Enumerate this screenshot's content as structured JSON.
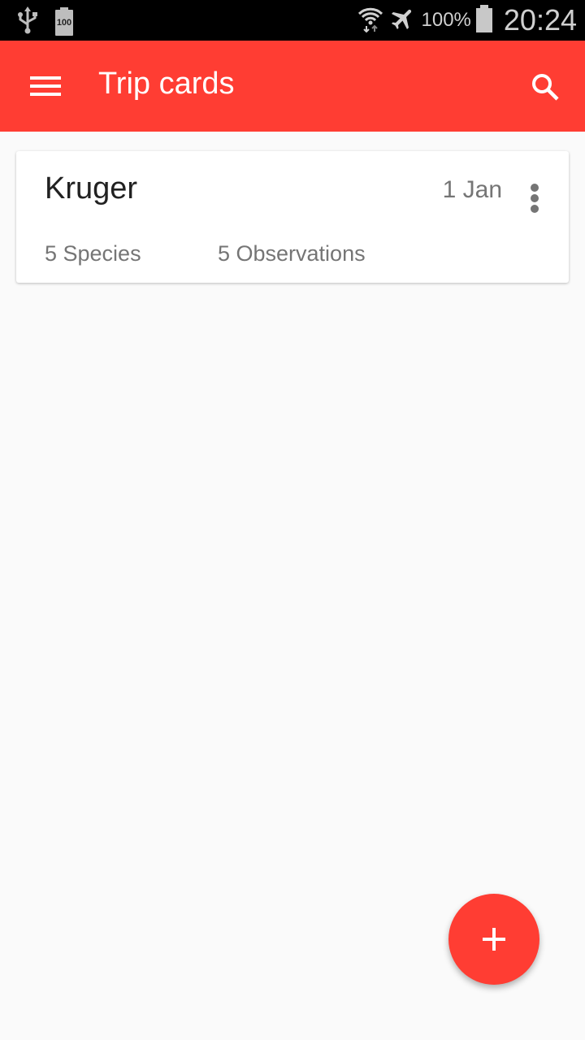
{
  "status_bar": {
    "icons_left": [
      "usb-icon",
      "battery-100-icon"
    ],
    "battery_small_label": "100",
    "icons_right": [
      "wifi-icon",
      "airplane-mode-icon",
      "battery-icon"
    ],
    "battery_percent": "100%",
    "time": "20:24"
  },
  "app_bar": {
    "title": "Trip cards",
    "background_color": "#ff3d33",
    "menu_icon": "hamburger-menu-icon",
    "search_icon": "search-icon"
  },
  "trips": [
    {
      "name": "Kruger",
      "date": "1 Jan",
      "species": "5 Species",
      "observations": "5 Observations"
    }
  ],
  "fab": {
    "icon": "plus-icon",
    "color": "#ff3d33"
  }
}
